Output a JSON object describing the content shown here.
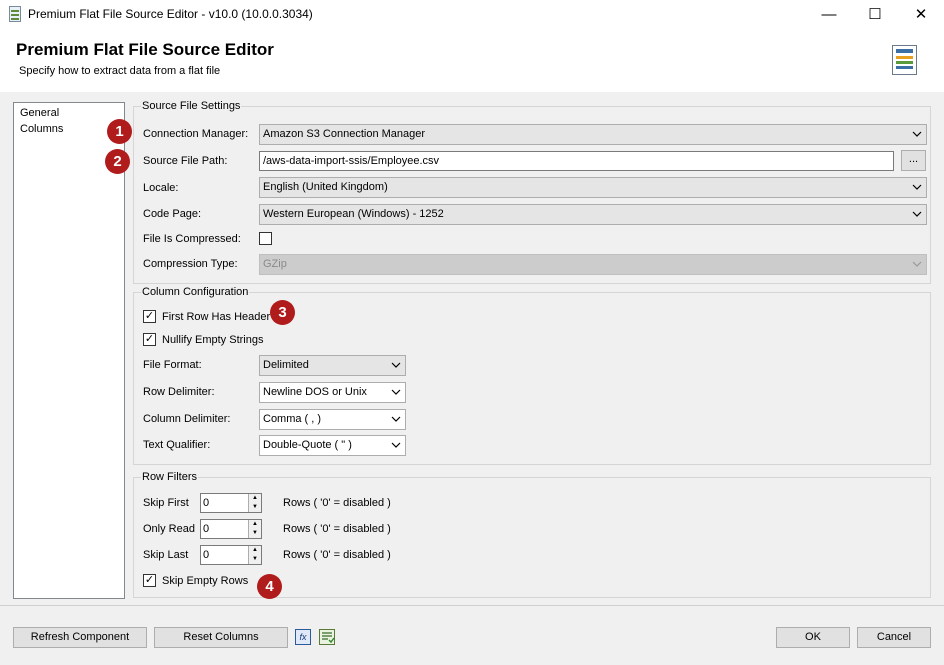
{
  "window": {
    "title": "Premium Flat File Source Editor - v10.0 (10.0.0.3034)",
    "minimize": "—",
    "maximize": "☐",
    "close": "✕"
  },
  "header": {
    "title": "Premium Flat File Source Editor",
    "subtitle": "Specify how to extract data from a flat file"
  },
  "nav": {
    "items": [
      "General",
      "Columns"
    ]
  },
  "source_file_settings": {
    "title": "Source File Settings",
    "connection_manager": {
      "label": "Connection Manager:",
      "value": "Amazon S3 Connection Manager"
    },
    "source_file_path": {
      "label": "Source File Path:",
      "value": "/aws-data-import-ssis/Employee.csv",
      "browse": "..."
    },
    "locale": {
      "label": "Locale:",
      "value": "English (United Kingdom)"
    },
    "code_page": {
      "label": "Code Page:",
      "value": "Western European (Windows) - 1252"
    },
    "file_is_compressed": {
      "label": "File Is Compressed:",
      "checked": false
    },
    "compression_type": {
      "label": "Compression Type:",
      "value": "GZip"
    }
  },
  "column_configuration": {
    "title": "Column Configuration",
    "first_row_has_header": {
      "label": "First Row Has Header",
      "checked": true
    },
    "nullify_empty_strings": {
      "label": "Nullify Empty Strings",
      "checked": true
    },
    "file_format": {
      "label": "File Format:",
      "value": "Delimited"
    },
    "row_delimiter": {
      "label": "Row Delimiter:",
      "value": "Newline DOS or Unix"
    },
    "column_delimiter": {
      "label": "Column Delimiter:",
      "value": "Comma ( , )"
    },
    "text_qualifier": {
      "label": "Text Qualifier:",
      "value": "Double-Quote ( \" )"
    }
  },
  "row_filters": {
    "title": "Row Filters",
    "skip_first": {
      "label": "Skip First",
      "value": "0",
      "suffix": "Rows ( '0' = disabled )"
    },
    "only_read": {
      "label": "Only Read",
      "value": "0",
      "suffix": "Rows ( '0' = disabled )"
    },
    "skip_last": {
      "label": "Skip Last",
      "value": "0",
      "suffix": "Rows ( '0' = disabled )"
    },
    "skip_empty_rows": {
      "label": "Skip Empty Rows",
      "checked": true
    }
  },
  "badges": [
    "1",
    "2",
    "3",
    "4"
  ],
  "footer": {
    "refresh_component": "Refresh Component",
    "reset_columns": "Reset Columns",
    "expression_icon": "fx",
    "ok": "OK",
    "cancel": "Cancel"
  },
  "colors": {
    "badge": "#b01b1b",
    "window_bg": "#f0f0f0"
  },
  "icons": {
    "dropdown": "chevron-down-icon",
    "check": "checkmark-icon"
  }
}
